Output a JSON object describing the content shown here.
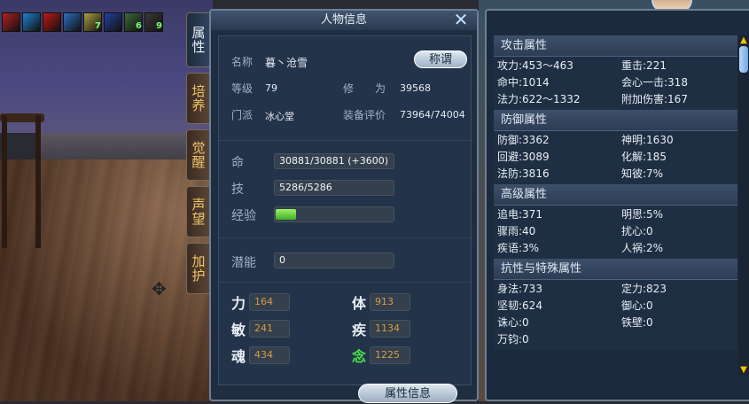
{
  "buffs": [
    {
      "icon": "red-mask-icon",
      "color": "#b02020",
      "count": ""
    },
    {
      "icon": "blue-wave-icon",
      "color": "#1f7fd0",
      "count": ""
    },
    {
      "icon": "red-orb-icon",
      "color": "#c01818",
      "count": ""
    },
    {
      "icon": "cross-sword-icon",
      "color": "#2a6ec0",
      "count": ""
    },
    {
      "icon": "vip-icon",
      "color": "#a8a040",
      "count": "7"
    },
    {
      "icon": "blue-sigil-icon",
      "color": "#2240a0",
      "count": ""
    },
    {
      "icon": "green-wings-icon",
      "color": "#3a6a3a",
      "count": "6"
    },
    {
      "icon": "green-gem-icon",
      "color": "#3a3a3a",
      "count": "9"
    }
  ],
  "tabs": [
    "属性",
    "培养",
    "觉醒",
    "声望",
    "加护"
  ],
  "panel": {
    "title": "人物信息",
    "close_icon": "close-icon",
    "name_label": "名称",
    "name_value": "暮丶沧雪",
    "title_button": "称谓",
    "level_label": "等级",
    "level_value": "79",
    "cult_label": "修　　为",
    "cult_value": "39568",
    "sect_label": "门派",
    "sect_value": "冰心堂",
    "gear_label": "装备评价",
    "gear_value": "73964/74004",
    "hp_label": "命",
    "hp_value": "30881/30881 (+3600)",
    "mp_label": "技",
    "mp_value": "5286/5286",
    "exp_label": "经验",
    "exp_fraction": 0.17,
    "potential_label": "潜能",
    "potential_value": "0",
    "stats": [
      {
        "label": "力",
        "value": "164",
        "label_color": "#e8eef5"
      },
      {
        "label": "体",
        "value": "913",
        "label_color": "#e8eef5"
      },
      {
        "label": "敏",
        "value": "241",
        "label_color": "#e8eef5"
      },
      {
        "label": "疾",
        "value": "1134",
        "label_color": "#e8eef5"
      },
      {
        "label": "魂",
        "value": "434",
        "label_color": "#e8eef5"
      },
      {
        "label": "念",
        "value": "1225",
        "label_color": "#48e04a"
      }
    ],
    "bottom_button": "属性信息"
  },
  "attributes": {
    "groups": [
      {
        "title": "攻击属性",
        "rows": [
          "攻力:453～463",
          "重击:221",
          "命中:1014",
          "会心一击:318",
          "法力:622～1332",
          "附加伤害:167"
        ]
      },
      {
        "title": "防御属性",
        "rows": [
          "防御:3362",
          "神明:1630",
          "回避:3089",
          "化解:185",
          "法防:3816",
          "知彼:7%"
        ]
      },
      {
        "title": "高级属性",
        "rows": [
          "追电:371",
          "明思:5%",
          "骤雨:40",
          "扰心:0",
          "疾语:3%",
          "人祸:2%"
        ]
      },
      {
        "title": "抗性与特殊属性",
        "rows": [
          "身法:733",
          "定力:823",
          "坚韧:624",
          "御心:0",
          "诛心:0",
          "铁壁:0",
          "万钧:0",
          ""
        ]
      }
    ]
  }
}
